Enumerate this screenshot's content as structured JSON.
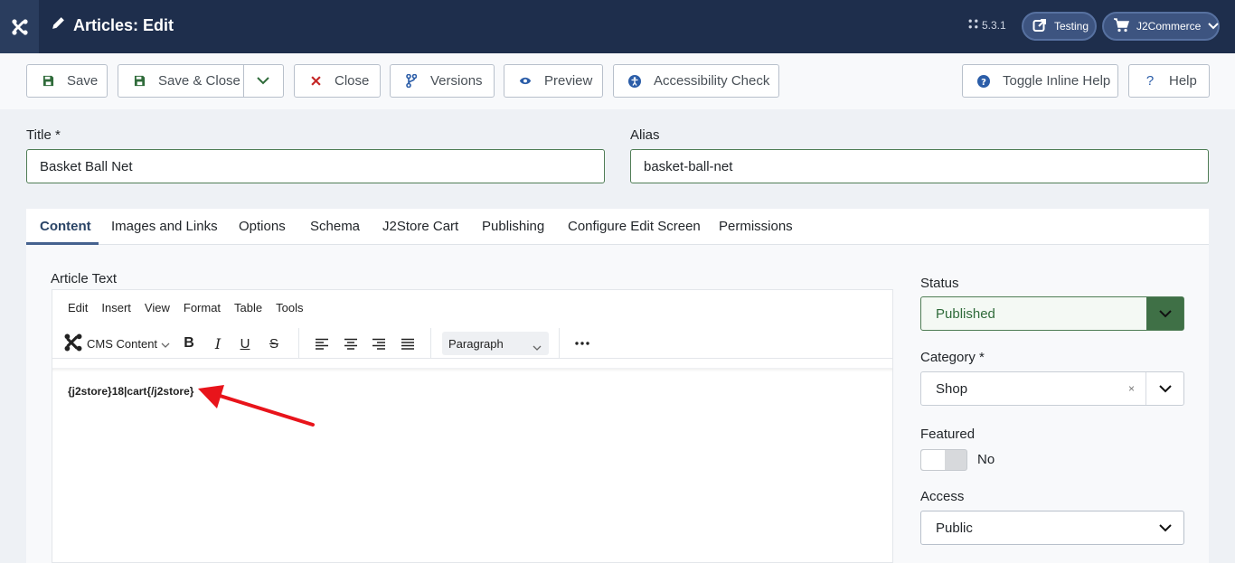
{
  "header": {
    "title": "Articles: Edit",
    "version": "5.3.1",
    "site_button": "Testing",
    "component_button": "J2Commerce"
  },
  "toolbar": {
    "save": "Save",
    "save_close": "Save & Close",
    "close": "Close",
    "versions": "Versions",
    "preview": "Preview",
    "accessibility": "Accessibility Check",
    "toggle_help": "Toggle Inline Help",
    "help": "Help"
  },
  "form": {
    "title_label": "Title *",
    "title_value": "Basket Ball Net",
    "alias_label": "Alias",
    "alias_value": "basket-ball-net"
  },
  "tabs": [
    {
      "label": "Content"
    },
    {
      "label": "Images and Links"
    },
    {
      "label": "Options"
    },
    {
      "label": "Schema"
    },
    {
      "label": "J2Store Cart"
    },
    {
      "label": "Publishing"
    },
    {
      "label": "Configure Edit Screen"
    },
    {
      "label": "Permissions"
    }
  ],
  "editor": {
    "label": "Article Text",
    "menu": [
      "Edit",
      "Insert",
      "View",
      "Format",
      "Table",
      "Tools"
    ],
    "cms_content": "CMS Content",
    "block_format": "Paragraph",
    "content": "{j2store}18|cart{/j2store}"
  },
  "sidebar": {
    "status_label": "Status",
    "status_value": "Published",
    "category_label": "Category *",
    "category_value": "Shop",
    "category_clear": "×",
    "featured_label": "Featured",
    "featured_value": "No",
    "access_label": "Access",
    "access_value": "Public"
  },
  "colors": {
    "header_bg": "#1e2e4c",
    "accent": "#45628f",
    "status_green": "#3f7046",
    "annotation_arrow": "#e8141b"
  }
}
